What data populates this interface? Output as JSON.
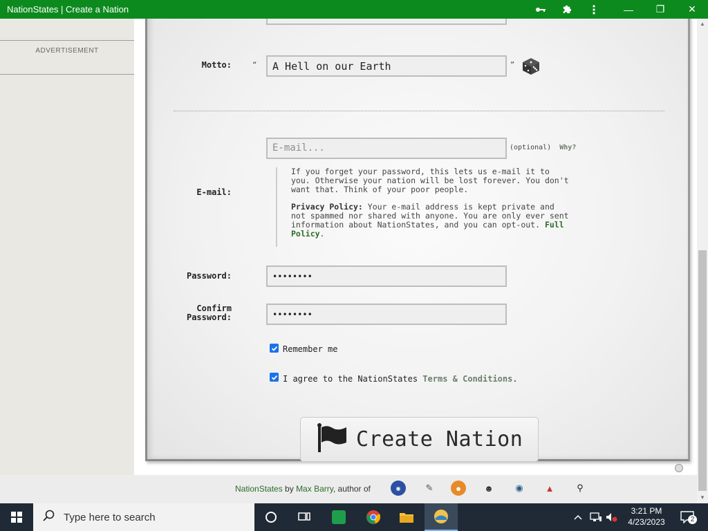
{
  "window": {
    "title": "NationStates | Create a Nation",
    "controls": {
      "minimize": "—",
      "maximize": "❐",
      "close": "✕"
    }
  },
  "sidebar": {
    "advertisement": "ADVERTISEMENT"
  },
  "form": {
    "motto": {
      "label": "Motto:",
      "open_quote": "“",
      "close_quote": "”",
      "value": "A Hell on our Earth"
    },
    "email": {
      "label": "E-mail:",
      "placeholder": "E-mail...",
      "optional": "(optional)",
      "why": "Why?",
      "note1": "If you forget your password, this lets us e-mail it to you. Otherwise your nation will be lost forever. You don't want that. Think of your poor people.",
      "privacy_label": "Privacy Policy:",
      "privacy_text": " Your e-mail address is kept private and not spammed nor shared with anyone. You are only ever sent information about NationStates, and you can opt-out. ",
      "privacy_link": "Full Policy",
      "privacy_end": "."
    },
    "password": {
      "label": "Password:",
      "value": "••••••••"
    },
    "confirm": {
      "label_line1": "Confirm",
      "label_line2": "Password:",
      "value": "••••••••"
    },
    "remember": {
      "label": "Remember me",
      "checked": true
    },
    "agree": {
      "prefix": "I agree to the NationStates ",
      "link": "Terms & Conditions",
      "suffix": ".",
      "checked": true
    },
    "create_button": "Create Nation"
  },
  "footer": {
    "site": "NationStates",
    "by": " by ",
    "author": "Max Barry",
    "author_of": ", author of"
  },
  "taskbar": {
    "search_placeholder": "Type here to search",
    "time": "3:21 PM",
    "date": "4/23/2023",
    "notifications": "2"
  },
  "colors": {
    "titlebar": "#0d8a1e",
    "link_green": "#2f6b2b",
    "checkbox": "#1a73e8",
    "taskbar": "#1f2a36"
  }
}
